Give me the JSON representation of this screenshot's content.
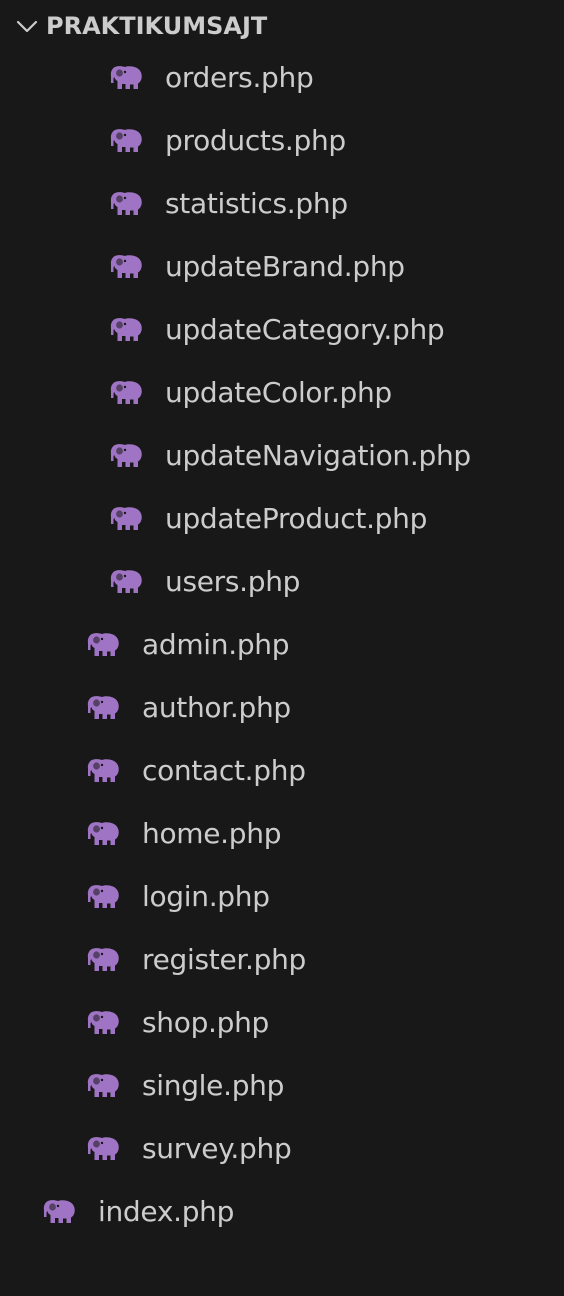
{
  "explorer": {
    "root": {
      "label": "PRAKTIKUMSAJT",
      "icon": "chevron-down-icon",
      "expanded": true
    },
    "file_icon": "php-elephant-icon",
    "colors": {
      "background": "#181818",
      "text": "#cccccc",
      "php_icon": "#a074c4"
    },
    "nested_files": [
      "orders.php",
      "products.php",
      "statistics.php",
      "updateBrand.php",
      "updateCategory.php",
      "updateColor.php",
      "updateNavigation.php",
      "updateProduct.php",
      "users.php"
    ],
    "folder_files": [
      "admin.php",
      "author.php",
      "contact.php",
      "home.php",
      "login.php",
      "register.php",
      "shop.php",
      "single.php",
      "survey.php"
    ],
    "root_files": [
      "index.php"
    ]
  }
}
